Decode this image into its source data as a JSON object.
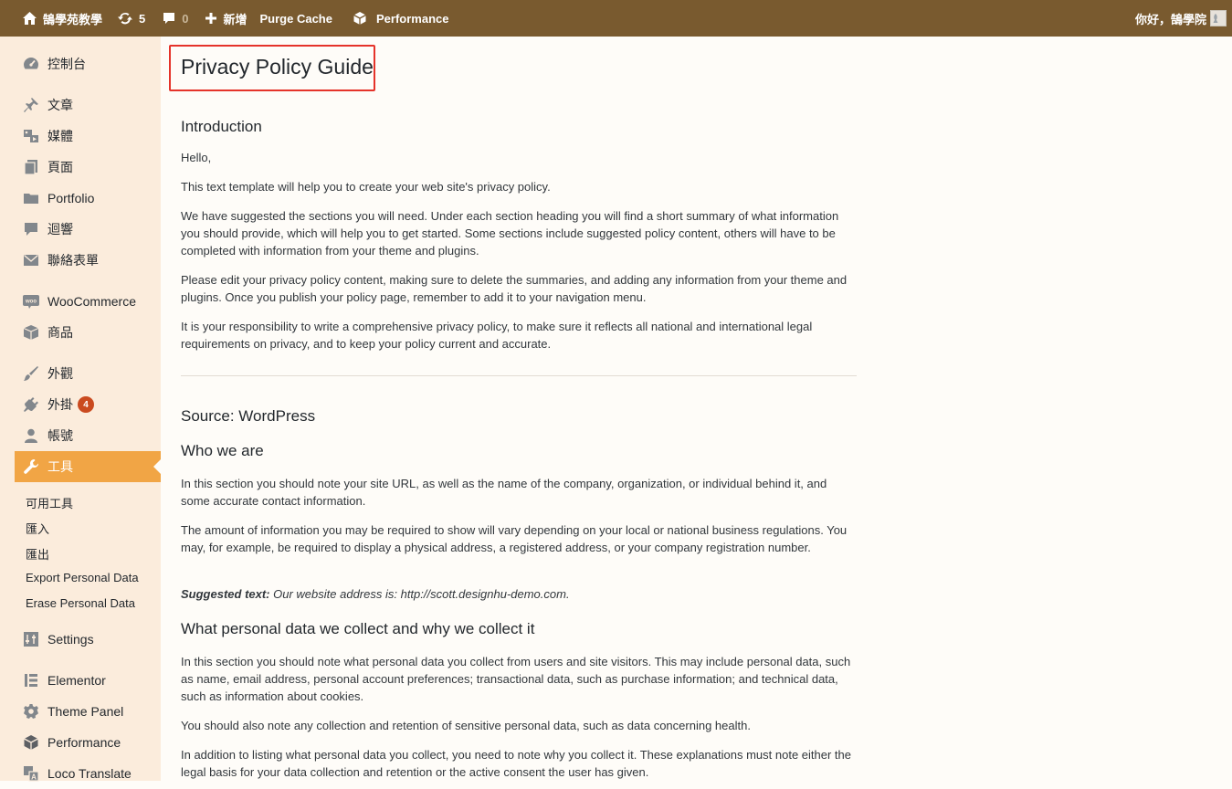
{
  "adminbar": {
    "site_name": "鵠學苑教學",
    "updates_count": "5",
    "comments_count": "0",
    "new_label": "新增",
    "purge_cache_label": "Purge Cache",
    "performance_label": "Performance",
    "greeting": "你好，鵠學院",
    "background_color": "#795a2f"
  },
  "sidebar": {
    "items": [
      {
        "label": "控制台",
        "icon": "dashboard-icon"
      },
      {
        "label": "文章",
        "icon": "pin-icon"
      },
      {
        "label": "媒體",
        "icon": "media-icon"
      },
      {
        "label": "頁面",
        "icon": "page-icon"
      },
      {
        "label": "Portfolio",
        "icon": "folder-icon"
      },
      {
        "label": "迴響",
        "icon": "comment-icon"
      },
      {
        "label": "聯絡表單",
        "icon": "mail-icon"
      },
      {
        "label": "WooCommerce",
        "icon": "woo-icon"
      },
      {
        "label": "商品",
        "icon": "box-icon"
      },
      {
        "label": "外觀",
        "icon": "brush-icon"
      },
      {
        "label": "外掛",
        "icon": "plugin-icon",
        "badge": "4"
      },
      {
        "label": "帳號",
        "icon": "user-icon"
      },
      {
        "label": "工具",
        "icon": "wrench-icon",
        "current": true
      },
      {
        "label": "Settings",
        "icon": "settings-icon"
      },
      {
        "label": "Elementor",
        "icon": "elementor-icon"
      },
      {
        "label": "Theme Panel",
        "icon": "gear-icon"
      },
      {
        "label": "Performance",
        "icon": "cube-icon"
      },
      {
        "label": "Loco Translate",
        "icon": "translate-icon"
      }
    ],
    "submenu": [
      {
        "label": "可用工具"
      },
      {
        "label": "匯入"
      },
      {
        "label": "匯出"
      },
      {
        "label": "Export Personal Data"
      },
      {
        "label": "Erase Personal Data"
      }
    ],
    "current_color": "#f1a545",
    "badge_color": "#ca4a1f"
  },
  "main": {
    "title": "Privacy Policy Guide",
    "highlight_color": "#e5332a",
    "intro": {
      "heading": "Introduction",
      "p1": "Hello,",
      "p2": "This text template will help you to create your web site's privacy policy.",
      "p3": "We have suggested the sections you will need. Under each section heading you will find a short summary of what information you should provide, which will help you to get started. Some sections include suggested policy content, others will have to be completed with information from your theme and plugins.",
      "p4": "Please edit your privacy policy content, making sure to delete the summaries, and adding any information from your theme and plugins. Once you publish your policy page, remember to add it to your navigation menu.",
      "p5": "It is your responsibility to write a comprehensive privacy policy, to make sure it reflects all national and international legal requirements on privacy, and to keep your policy current and accurate."
    },
    "source": {
      "heading": "Source: WordPress",
      "who_heading": "Who we are",
      "who_p1": "In this section you should note your site URL, as well as the name of the company, organization, or individual behind it, and some accurate contact information.",
      "who_p2": "The amount of information you may be required to show will vary depending on your local or national business regulations. You may, for example, be required to display a physical address, a registered address, or your company registration number.",
      "suggested_label": "Suggested text:",
      "suggested_text": "Our website address is: http://scott.designhu-demo.com.",
      "collect_heading": "What personal data we collect and why we collect it",
      "collect_p1": "In this section you should note what personal data you collect from users and site visitors. This may include personal data, such as name, email address, personal account preferences; transactional data, such as purchase information; and technical data, such as information about cookies.",
      "collect_p2": "You should also note any collection and retention of sensitive personal data, such as data concerning health.",
      "collect_p3": "In addition to listing what personal data you collect, you need to note why you collect it. These explanations must note either the legal basis for your data collection and retention or the active consent the user has given."
    }
  }
}
